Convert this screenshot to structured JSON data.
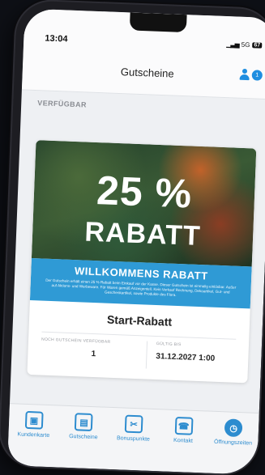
{
  "status_bar": {
    "time": "13:04",
    "signal": "▁▃▅",
    "network": "5G",
    "battery": "67"
  },
  "header": {
    "title": "Gutscheine",
    "profile_count": "1"
  },
  "section": {
    "label": "VERFÜGBAR"
  },
  "voucher": {
    "hero_big": "25 %",
    "hero_sub": "RABATT",
    "band_title": "WILLKOMMENS RABATT",
    "band_text": "Der Gutschein erhält einen 25 % Rabatt beim Einkauf vor der Kasse. Dieser Gutschein ist einmalig einlösbar. Außer auf Aktions- und Werbeware. Für Waren gemäß Anzeigenteil. Kein Verkauf Rechnung, Dekoartikel, Gut- und Geschenkartikel, sowie Produkte des Flora.",
    "name": "Start-Rabatt",
    "remaining_label": "NOCH GUTSCHEIN VERFÜGBAR",
    "remaining_value": "1",
    "valid_label": "GÜLTIG BIS",
    "valid_value": "31.12.2027 1:00"
  },
  "tabs": [
    {
      "label": "Kundenkarte",
      "icon": "card-icon",
      "glyph": "▣"
    },
    {
      "label": "Gutscheine",
      "icon": "voucher-icon",
      "glyph": "▤"
    },
    {
      "label": "Bonuspunkte",
      "icon": "bonus-icon",
      "glyph": "✂"
    },
    {
      "label": "Kontakt",
      "icon": "contact-icon",
      "glyph": "☎"
    },
    {
      "label": "Öffnungszeiten",
      "icon": "clock-icon",
      "glyph": "◷"
    }
  ],
  "colors": {
    "accent": "#2f9ad5",
    "brand_blue": "#1f8ee0"
  }
}
